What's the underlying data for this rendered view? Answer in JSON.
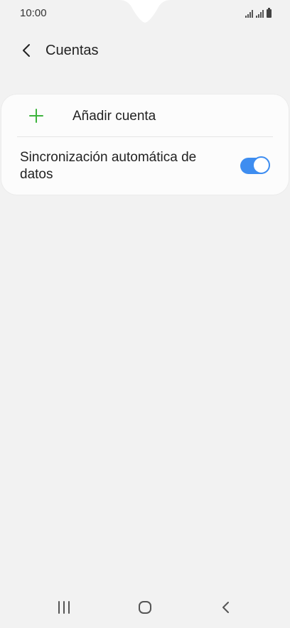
{
  "status_bar": {
    "time": "10:00"
  },
  "app_bar": {
    "title": "Cuentas",
    "back_icon": "chevron-left-icon"
  },
  "accounts": {
    "add_account_label": "Añadir cuenta",
    "add_icon": "plus-icon",
    "sync_label": "Sincronización automática de datos",
    "sync_enabled": true
  },
  "nav_bar": {
    "recents_icon": "recents-icon",
    "home_icon": "home-icon",
    "back_icon": "back-icon"
  },
  "colors": {
    "accent": "#3e8df0",
    "plus": "#3cb43c",
    "background": "#f2f2f2",
    "card": "#fcfcfc"
  }
}
